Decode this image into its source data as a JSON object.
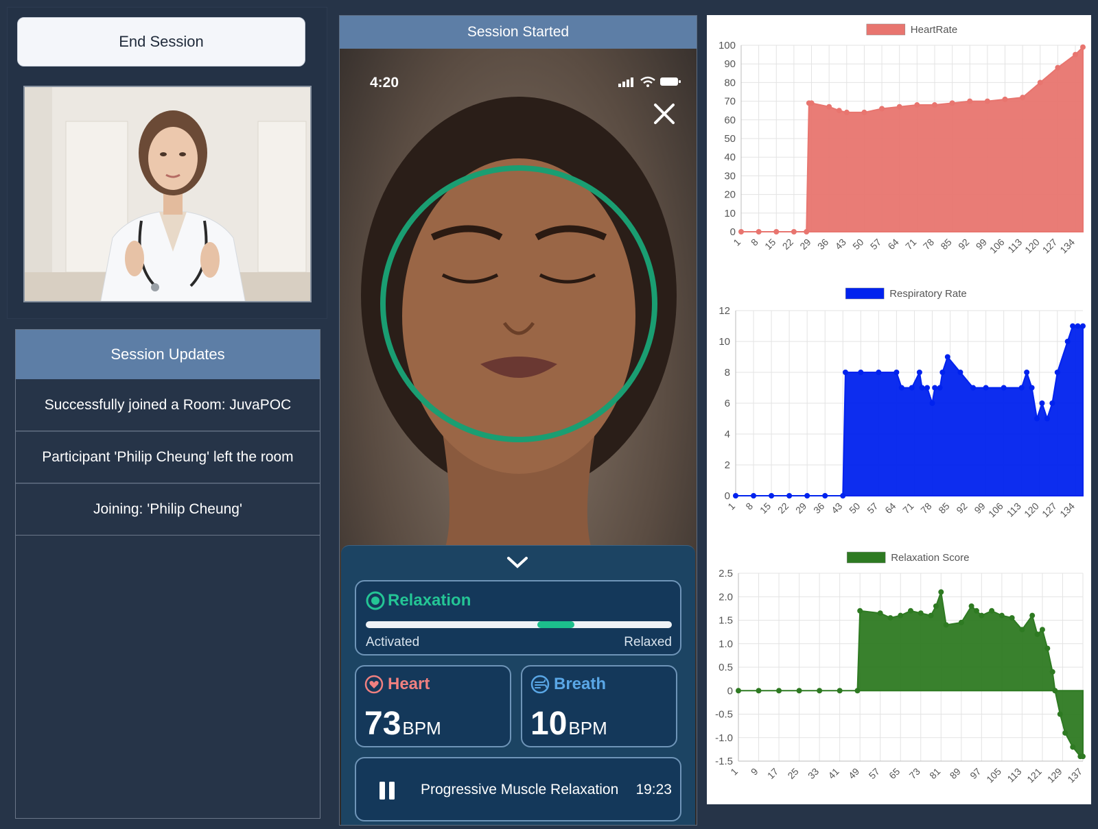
{
  "left": {
    "end_session_label": "End Session",
    "updates_title": "Session Updates",
    "updates": [
      "Successfully joined a Room: JuvaPOC",
      "Participant 'Philip Cheung' left the room",
      "Joining: 'Philip Cheung'"
    ]
  },
  "phone": {
    "header": "Session Started",
    "time": "4:20",
    "relaxation": {
      "title": "Relaxation",
      "left_label": "Activated",
      "right_label": "Relaxed",
      "level": 0.62
    },
    "heart": {
      "title": "Heart",
      "value": "73",
      "unit": "BPM"
    },
    "breath": {
      "title": "Breath",
      "value": "10",
      "unit": "BPM"
    },
    "session": {
      "name": "Progressive Muscle Relaxation",
      "time": "19:23"
    }
  },
  "colors": {
    "accent_green": "#24c595",
    "heart_pink": "#f08080",
    "breath_blue": "#5aa7e6",
    "header_blue": "#5d7ea6"
  },
  "chart_data": [
    {
      "type": "area",
      "legend": "HeartRate",
      "color": "#e8756f",
      "ylim": [
        0,
        100
      ],
      "yticks": [
        "0",
        "10",
        "20",
        "30",
        "40",
        "50",
        "60",
        "70",
        "80",
        "90",
        "100"
      ],
      "xticks": [
        "1",
        "8",
        "15",
        "22",
        "29",
        "36",
        "43",
        "50",
        "57",
        "64",
        "71",
        "78",
        "85",
        "92",
        "99",
        "106",
        "113",
        "120",
        "127",
        "134"
      ],
      "x": [
        1,
        8,
        15,
        22,
        27,
        28,
        29,
        36,
        40,
        43,
        50,
        57,
        64,
        71,
        78,
        85,
        92,
        99,
        106,
        113,
        120,
        127,
        134,
        137
      ],
      "values": [
        0,
        0,
        0,
        0,
        0,
        69,
        69,
        67,
        65,
        64,
        64,
        66,
        67,
        68,
        68,
        69,
        70,
        70,
        71,
        72,
        80,
        88,
        95,
        99
      ]
    },
    {
      "type": "area",
      "legend": "Respiratory Rate",
      "color": "#0022ee",
      "ylim": [
        0,
        12
      ],
      "yticks": [
        "0",
        "2",
        "4",
        "6",
        "8",
        "10",
        "12"
      ],
      "xticks": [
        "1",
        "8",
        "15",
        "22",
        "29",
        "36",
        "43",
        "50",
        "57",
        "64",
        "71",
        "78",
        "85",
        "92",
        "99",
        "106",
        "113",
        "120",
        "127",
        "134"
      ],
      "x": [
        1,
        8,
        15,
        22,
        29,
        36,
        43,
        44,
        50,
        57,
        64,
        66,
        70,
        73,
        74,
        76,
        78,
        79,
        81,
        82,
        84,
        89,
        94,
        99,
        106,
        113,
        115,
        117,
        119,
        121,
        123,
        125,
        127,
        131,
        133,
        135,
        137
      ],
      "values": [
        0,
        0,
        0,
        0,
        0,
        0,
        0,
        8,
        8,
        8,
        8,
        7,
        7,
        8,
        7,
        7,
        6,
        7,
        7,
        8,
        9,
        8,
        7,
        7,
        7,
        7,
        8,
        7,
        5,
        6,
        5,
        6,
        8,
        10,
        11,
        11,
        11
      ]
    },
    {
      "type": "area",
      "legend": "Relaxation Score",
      "color": "#2e7a22",
      "ylim": [
        -1.5,
        2.5
      ],
      "yticks": [
        "-1.5",
        "-1.0",
        "-0.5",
        "0",
        "0.5",
        "1.0",
        "1.5",
        "2.0",
        "2.5"
      ],
      "xticks": [
        "1",
        "9",
        "17",
        "25",
        "33",
        "41",
        "49",
        "57",
        "65",
        "73",
        "81",
        "89",
        "97",
        "105",
        "113",
        "121",
        "129",
        "137"
      ],
      "x": [
        1,
        9,
        17,
        25,
        33,
        41,
        48,
        49,
        57,
        61,
        65,
        69,
        73,
        77,
        79,
        81,
        83,
        89,
        93,
        95,
        97,
        101,
        105,
        109,
        113,
        117,
        119,
        121,
        123,
        125,
        126,
        128,
        130,
        133,
        136,
        137
      ],
      "values": [
        0,
        0,
        0,
        0,
        0,
        0,
        0,
        1.7,
        1.65,
        1.55,
        1.6,
        1.7,
        1.65,
        1.6,
        1.8,
        2.1,
        1.4,
        1.45,
        1.8,
        1.7,
        1.6,
        1.7,
        1.6,
        1.55,
        1.3,
        1.6,
        1.2,
        1.3,
        0.9,
        0.4,
        0.0,
        -0.5,
        -0.9,
        -1.2,
        -1.4,
        -1.4
      ]
    }
  ]
}
